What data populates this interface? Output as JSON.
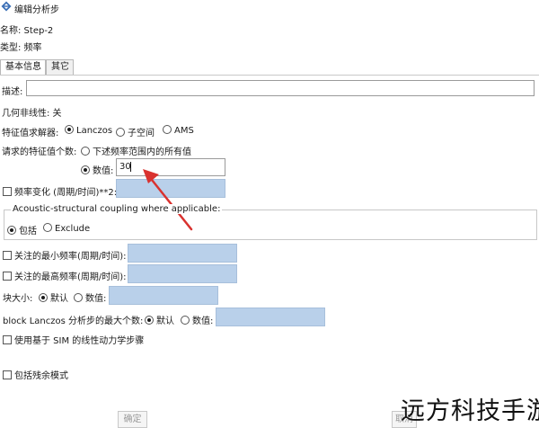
{
  "window": {
    "title": "编辑分析步"
  },
  "info": {
    "name_label": "名称: Step-2",
    "type_label": "类型: 频率"
  },
  "tabs": [
    {
      "label": "基本信息"
    },
    {
      "label": "其它"
    }
  ],
  "form": {
    "description_label": "描述:",
    "description_value": "",
    "nlgeom_label": "几何非线性: 关",
    "eigensolver": {
      "label": "特征值求解器:",
      "options": [
        "Lanczos",
        "子空间",
        "AMS"
      ],
      "selected": "Lanczos"
    },
    "eigen_request": {
      "label": "请求的特征值个数:",
      "option_all": "下述频率范围内的所有值",
      "option_value": "数值:",
      "value": "30"
    },
    "freq_shift": {
      "label": "频率变化 (周期/时间)**2:",
      "value": ""
    },
    "acoustic": {
      "legend": "Acoustic-structural coupling where applicable:",
      "option_include": "包括",
      "option_exclude": "Exclude"
    },
    "min_freq": {
      "label": "关注的最小频率(周期/时间):",
      "value": ""
    },
    "max_freq": {
      "label": "关注的最高频率(周期/时间):",
      "value": ""
    },
    "block_size": {
      "label": "块大小:",
      "option_default": "默认",
      "option_value": "数值:",
      "value": ""
    },
    "block_lanczos": {
      "label": "block Lanczos 分析步的最大个数:",
      "option_default": "默认",
      "option_value": "数值:",
      "value": ""
    },
    "sim_label": "使用基于 SIM 的线性动力学步骤",
    "residual_label": "包括残余模式"
  },
  "buttons": {
    "ok": "确定",
    "cancel": "取消"
  },
  "watermark": "远方科技手游",
  "colors": {
    "field_blue": "#b9d0ea",
    "annotation_red": "#d9322f"
  }
}
